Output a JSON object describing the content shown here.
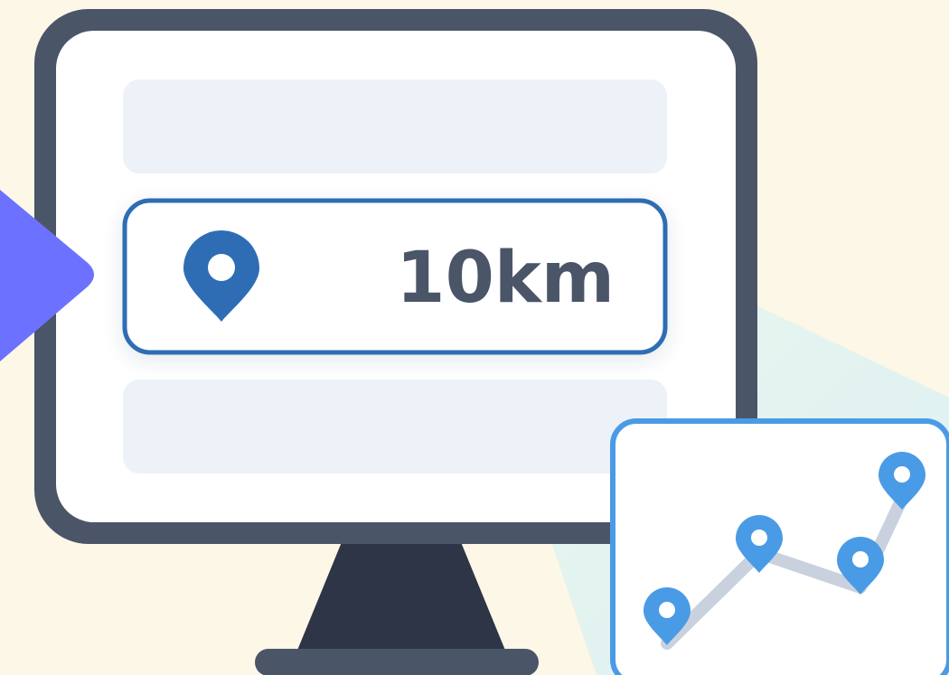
{
  "distance_card": {
    "value": "10km",
    "icon": "location-pin-icon"
  },
  "route_card": {
    "icon": "route-map-icon",
    "pins": 4
  },
  "colors": {
    "background": "#fcf7e6",
    "monitor_frame": "#4a5568",
    "monitor_stand": "#2e3547",
    "screen": "#ffffff",
    "placeholder": "#edf1f8",
    "accent_blue": "#2e6db4",
    "pin_blue": "#4a9be5",
    "route_line": "#c9d1df",
    "arrow": "#6c72ff",
    "text": "#4a5568"
  }
}
